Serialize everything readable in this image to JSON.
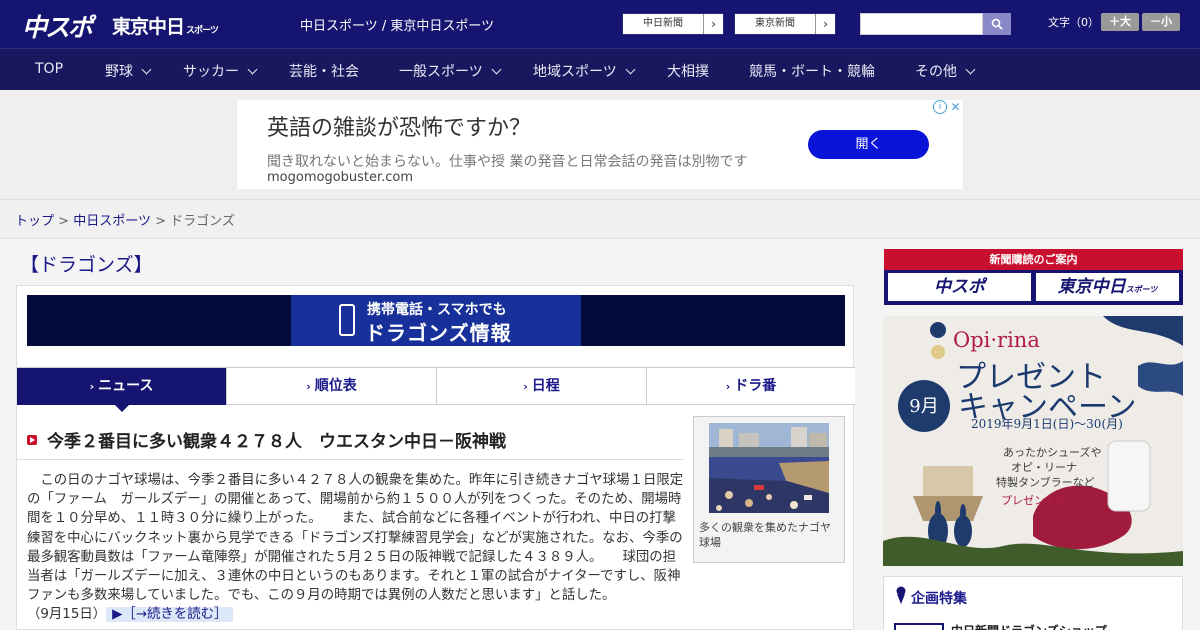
{
  "header": {
    "logo_chunichi": "中スポ",
    "logo_tokyo": "東京中日",
    "logo_tokyo_small": "スポーツ",
    "title": "中日スポーツ / 東京中日スポーツ",
    "paper_buttons": [
      {
        "label": "中日新聞"
      },
      {
        "label": "東京新聞"
      }
    ],
    "search_placeholder": "",
    "font_size_label": "文字（0）",
    "font_larger": "＋大",
    "font_smaller": "－小"
  },
  "nav": {
    "items": [
      {
        "label": "TOP",
        "has_menu": false
      },
      {
        "label": "野球",
        "has_menu": true
      },
      {
        "label": "サッカー",
        "has_menu": true
      },
      {
        "label": "芸能・社会",
        "has_menu": false
      },
      {
        "label": "一般スポーツ",
        "has_menu": true
      },
      {
        "label": "地域スポーツ",
        "has_menu": true
      },
      {
        "label": "大相撲",
        "has_menu": false
      },
      {
        "label": "競馬・ボート・競輪",
        "has_menu": false
      },
      {
        "label": "その他",
        "has_menu": true
      }
    ]
  },
  "ad": {
    "title": "英語の雑談が恐怖ですか？",
    "description": "聞き取れないと始まらない。仕事や授 業の発音と日常会話の発音は別物です",
    "url": "mogomogobuster.com",
    "button": "開く",
    "info_icon": "i",
    "close_icon": "✕"
  },
  "breadcrumb": {
    "items": [
      {
        "label": "トップ",
        "link": true
      },
      {
        "label": "中日スポーツ",
        "link": true
      },
      {
        "label": "ドラゴンズ",
        "link": false
      }
    ],
    "separator": ">"
  },
  "section_title": "【ドラゴンズ】",
  "banner": {
    "line1": "携帯電話・スマホでも",
    "line2": "ドラゴンズ情報"
  },
  "tabs": [
    {
      "label": "ニュース",
      "active": true
    },
    {
      "label": "順位表",
      "active": false
    },
    {
      "label": "日程",
      "active": false
    },
    {
      "label": "ドラ番",
      "active": false
    }
  ],
  "article": {
    "title": "今季２番目に多い観衆４２７８人　ウエスタン中日－阪神戦",
    "body": "　この日のナゴヤ球場は、今季２番目に多い４２７８人の観衆を集めた。昨年に引き続きナゴヤ球場１日限定の「ファーム　ガールズデー」の開催とあって、開場前から約１５００人が列をつくった。そのため、開場時間を１０分早め、１１時３０分に繰り上がった。　　また、試合前などに各種イベントが行われ、中日の打撃練習を中心にバックネット裏から見学できる「ドラゴンズ打撃練習見学会」などが実施された。なお、今季の最多観客動員数は「ファーム竜陣祭」が開催された５月２５日の阪神戦で記録した４３８９人。　　球団の担当者は「ガールズデーに加え、３連休の中日というのもあります。それと１軍の試合がナイターですし、阪神ファンも多数来場していました。でも、この９月の時期では異例の人数だと思います」と話した。",
    "date": "（9月15日）",
    "read_more": "▶［→続きを読む］",
    "photo_caption": "多くの観衆を集めたナゴヤ球場"
  },
  "sidebar": {
    "subscription_heading": "新聞購読のご案内",
    "subscription_buttons": [
      "中スポ",
      "東京中日"
    ],
    "subscription_small": "スポーツ",
    "campaign": {
      "brand": "Opi·rina",
      "line_present": "プレゼント",
      "line_campaign": "キャンペーン",
      "month": "9月",
      "dates": "2019年9月1日(日)～30(月)",
      "copy_1": "あったかシューズや",
      "copy_2": "オピ・リーナ",
      "copy_3": "特製タンブラーなど",
      "copy_4": "プレゼント!!"
    },
    "plan_title": "企画特集",
    "plan_item": "中日新聞ドラゴンズショップ"
  },
  "colors": {
    "header_navy": "#151470",
    "accent_red": "#c8102e",
    "link_blue": "#1c1a8a"
  }
}
